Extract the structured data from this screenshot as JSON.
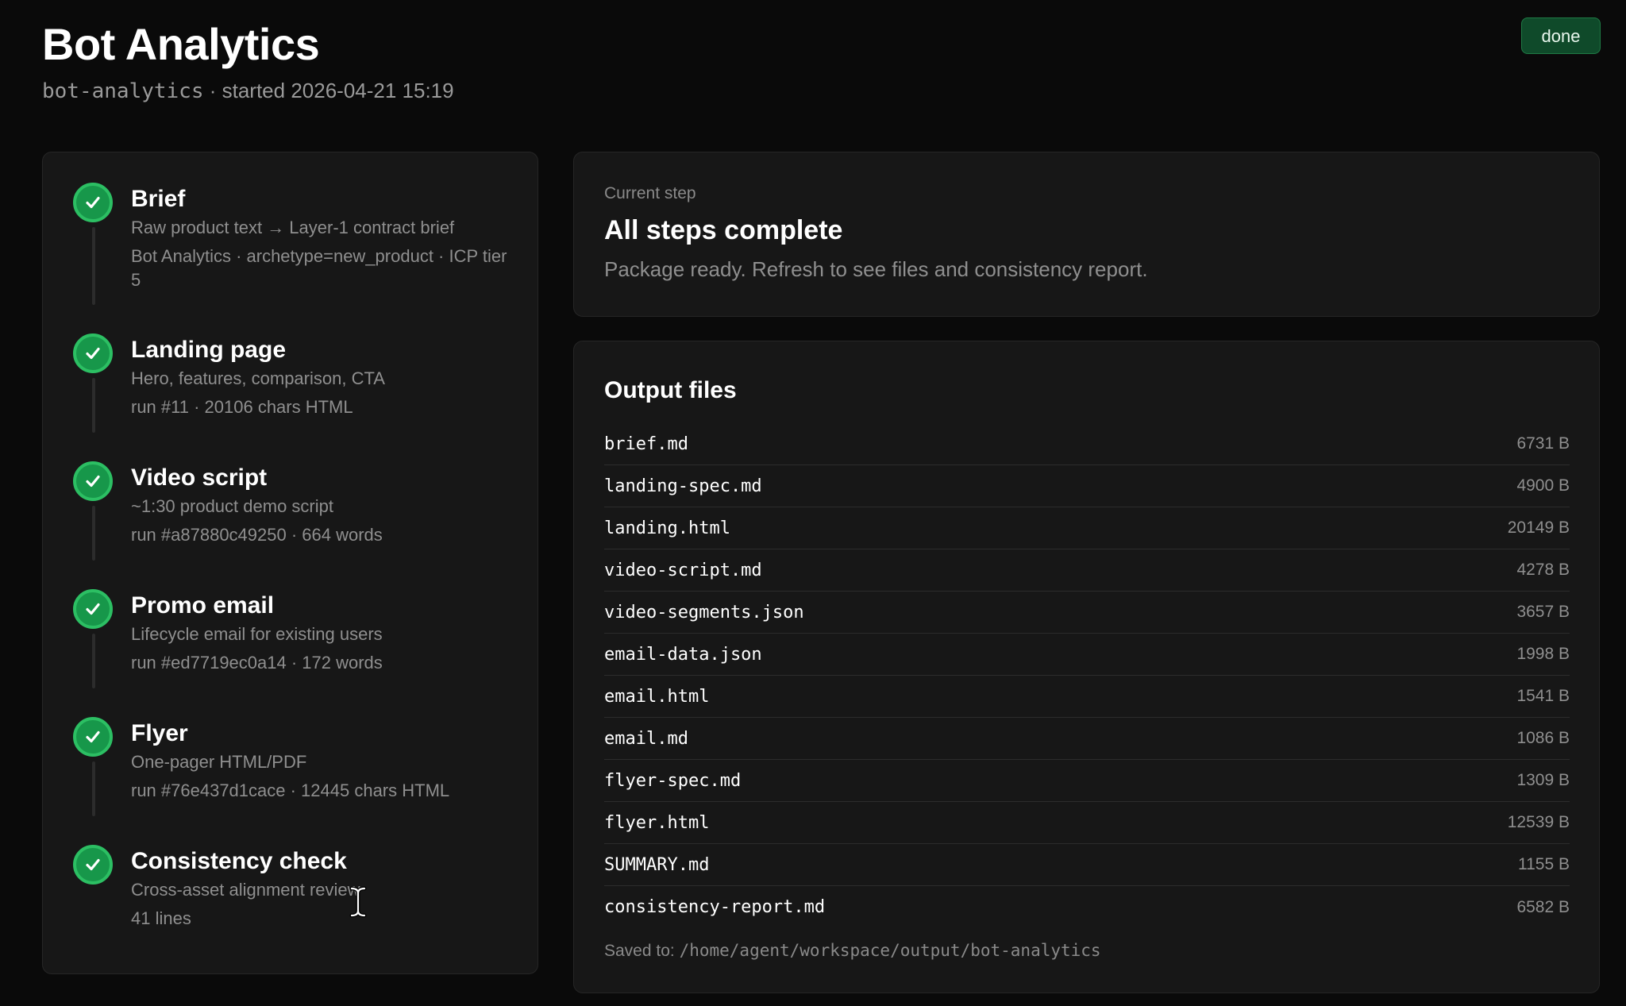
{
  "header": {
    "title": "Bot Analytics",
    "slug": "bot-analytics",
    "started_text": " · started 2026-04-21 15:19",
    "status": "done"
  },
  "steps": [
    {
      "title": "Brief",
      "description": "Raw product text → Layer-1 contract brief",
      "detail": "Bot Analytics · archetype=new_product · ICP tier 5",
      "status_icon": "check-icon"
    },
    {
      "title": "Landing page",
      "description": "Hero, features, comparison, CTA",
      "detail": "run #11 · 20106 chars HTML",
      "status_icon": "check-icon"
    },
    {
      "title": "Video script",
      "description": "~1:30 product demo script",
      "detail": "run #a87880c49250 · 664 words",
      "status_icon": "check-icon"
    },
    {
      "title": "Promo email",
      "description": "Lifecycle email for existing users",
      "detail": "run #ed7719ec0a14 · 172 words",
      "status_icon": "check-icon"
    },
    {
      "title": "Flyer",
      "description": "One-pager HTML/PDF",
      "detail": "run #76e437d1cace · 12445 chars HTML",
      "status_icon": "check-icon"
    },
    {
      "title": "Consistency check",
      "description": "Cross-asset alignment review",
      "detail": "41 lines",
      "status_icon": "check-icon"
    }
  ],
  "current_step": {
    "label": "Current step",
    "title": "All steps complete",
    "description": "Package ready. Refresh to see files and consistency report."
  },
  "output": {
    "title": "Output files",
    "files": [
      {
        "name": "brief.md",
        "size": "6731 B"
      },
      {
        "name": "landing-spec.md",
        "size": "4900 B"
      },
      {
        "name": "landing.html",
        "size": "20149 B"
      },
      {
        "name": "video-script.md",
        "size": "4278 B"
      },
      {
        "name": "video-segments.json",
        "size": "3657 B"
      },
      {
        "name": "email-data.json",
        "size": "1998 B"
      },
      {
        "name": "email.html",
        "size": "1541 B"
      },
      {
        "name": "email.md",
        "size": "1086 B"
      },
      {
        "name": "flyer-spec.md",
        "size": "1309 B"
      },
      {
        "name": "flyer.html",
        "size": "12539 B"
      },
      {
        "name": "SUMMARY.md",
        "size": "1155 B"
      },
      {
        "name": "consistency-report.md",
        "size": "6582 B"
      }
    ],
    "saved_label": "Saved to: ",
    "saved_path": "/home/agent/workspace/output/bot-analytics"
  },
  "colors": {
    "background": "#0a0a0a",
    "card": "#171717",
    "success": "#17974a",
    "badge": "#0f4a2a"
  }
}
